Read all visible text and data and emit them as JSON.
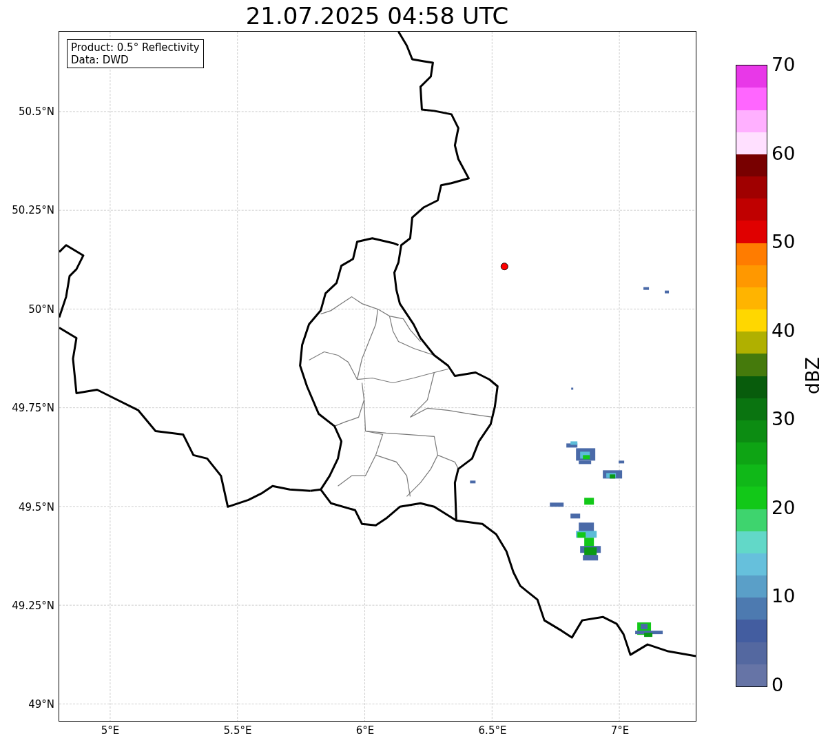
{
  "title": "21.07.2025 04:58 UTC",
  "legend": [
    "Product: 0.5° Reflectivity",
    "Data: DWD"
  ],
  "axes": {
    "y_tick_labels": [
      "50.5°N",
      "50.25°N",
      "50°N",
      "49.75°N",
      "49.5°N",
      "49.25°N",
      "49°N"
    ],
    "x_tick_labels": [
      "5°E",
      "5.5°E",
      "6°E",
      "6.5°E",
      "7°E"
    ]
  },
  "colorbar": {
    "label": "dBZ",
    "tick_labels": [
      "70",
      "60",
      "50",
      "40",
      "30",
      "20",
      "10",
      "0"
    ],
    "segments": [
      {
        "color": "#6674a6"
      },
      {
        "color": "#5468a0"
      },
      {
        "color": "#435da0"
      },
      {
        "color": "#4d7ab0"
      },
      {
        "color": "#5a9fc8"
      },
      {
        "color": "#66c0dc"
      },
      {
        "color": "#62d8c8"
      },
      {
        "color": "#3ed46e"
      },
      {
        "color": "#12c818"
      },
      {
        "color": "#10b818"
      },
      {
        "color": "#0ea414"
      },
      {
        "color": "#0c8c12"
      },
      {
        "color": "#0a7410"
      },
      {
        "color": "#085c0c"
      },
      {
        "color": "#457a0c"
      },
      {
        "color": "#b0b000"
      },
      {
        "color": "#ffd700"
      },
      {
        "color": "#ffb400"
      },
      {
        "color": "#ff9800"
      },
      {
        "color": "#ff7c00"
      },
      {
        "color": "#e00000"
      },
      {
        "color": "#c00000"
      },
      {
        "color": "#a00000"
      },
      {
        "color": "#780000"
      },
      {
        "color": "#ffe0ff"
      },
      {
        "color": "#ffb0ff"
      },
      {
        "color": "#ff66ff"
      },
      {
        "color": "#e838e8"
      }
    ]
  }
}
